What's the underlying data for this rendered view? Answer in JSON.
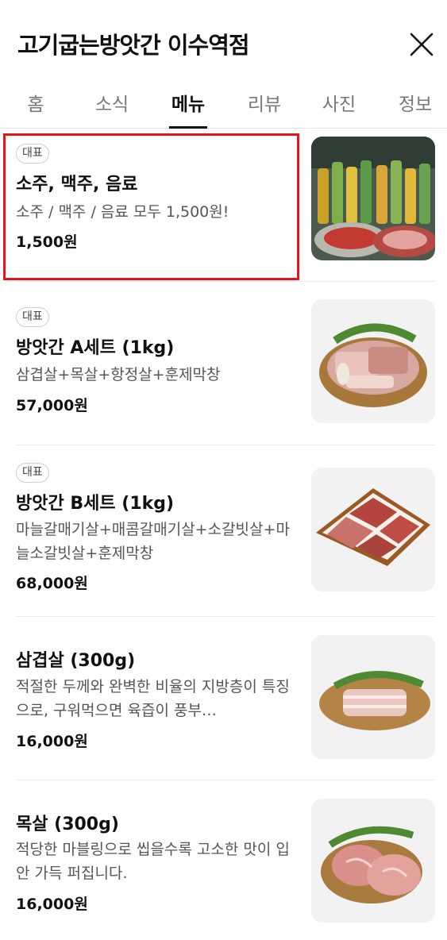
{
  "header": {
    "title": "고기굽는방앗간 이수역점",
    "close_icon": "close-icon"
  },
  "tabs": [
    {
      "label": "홈",
      "active": false
    },
    {
      "label": "소식",
      "active": false
    },
    {
      "label": "메뉴",
      "active": true
    },
    {
      "label": "리뷰",
      "active": false
    },
    {
      "label": "사진",
      "active": false
    },
    {
      "label": "정보",
      "active": false
    }
  ],
  "menu": [
    {
      "badge": "대표",
      "name": "소주, 맥주, 음료",
      "desc": "소주 / 맥주 / 음료 모두 1,500원!",
      "price": "1,500원",
      "image": "drinks-photo"
    },
    {
      "badge": "대표",
      "name": "방앗간 A세트 (1kg)",
      "desc": "삼겹살+목살+항정살+훈제막창",
      "price": "57,000원",
      "image": "a-set-photo"
    },
    {
      "badge": "대표",
      "name": "방앗간 B세트 (1kg)",
      "desc": "마늘갈매기살+매콤갈매기살+소갈빗살+마늘소갈빗살+훈제막창",
      "price": "68,000원",
      "image": "b-set-photo"
    },
    {
      "badge": "",
      "name": "삼겹살 (300g)",
      "desc": "적절한 두께와 완벽한 비율의 지방층이 특징으로, 구워먹으면 육즙이 풍부…",
      "price": "16,000원",
      "image": "pork-belly-photo"
    },
    {
      "badge": "",
      "name": "목살 (300g)",
      "desc": "적당한 마블링으로 씹을수록 고소한 맛이 입안 가득 퍼집니다.",
      "price": "16,000원",
      "image": "pork-neck-photo"
    }
  ],
  "colors": {
    "highlight": "#e8131b",
    "text": "#111111",
    "muted": "#555555"
  }
}
